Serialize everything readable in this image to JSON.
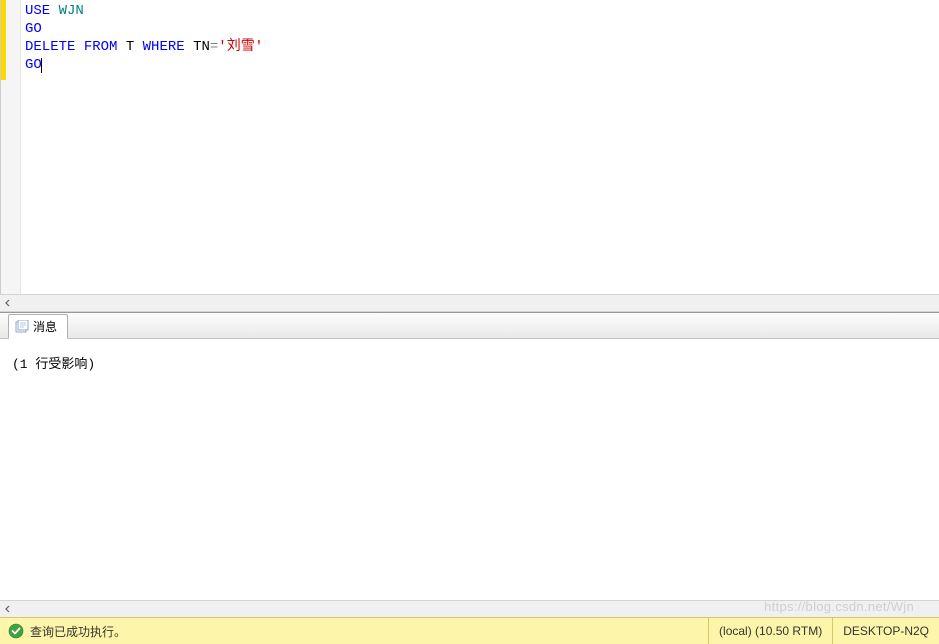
{
  "editor": {
    "lines": [
      {
        "tokens": [
          {
            "text": "USE",
            "class": "kw-blue"
          },
          {
            "text": " "
          },
          {
            "text": "WJN",
            "class": "kw-teal"
          }
        ]
      },
      {
        "tokens": [
          {
            "text": "GO",
            "class": "kw-blue"
          }
        ]
      },
      {
        "tokens": [
          {
            "text": "DELETE",
            "class": "kw-blue"
          },
          {
            "text": " "
          },
          {
            "text": "FROM",
            "class": "kw-blue"
          },
          {
            "text": " T "
          },
          {
            "text": "WHERE",
            "class": "kw-blue"
          },
          {
            "text": " TN"
          },
          {
            "text": "=",
            "class": "kw-gray"
          },
          {
            "text": "'刘雪'",
            "class": "kw-red"
          }
        ]
      },
      {
        "tokens": [
          {
            "text": "GO",
            "class": "kw-blue"
          }
        ],
        "cursor": true
      }
    ]
  },
  "tabs": {
    "messages_label": "消息"
  },
  "messages": {
    "line1": "(1 行受影响)"
  },
  "status": {
    "success_text": "查询已成功执行。",
    "server": "(local) (10.50 RTM)",
    "host": "DESKTOP-N2Q"
  },
  "watermark": "https://blog.csdn.net/Wjn"
}
